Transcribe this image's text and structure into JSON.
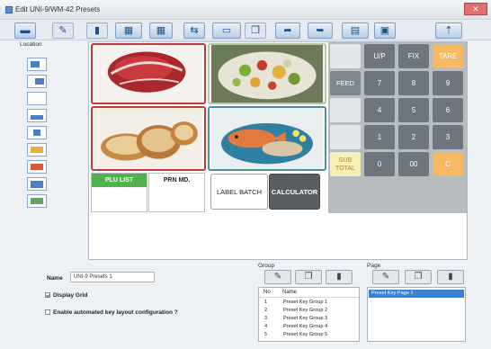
{
  "window": {
    "title": "Edit UNI-9/WM-42 Presets"
  },
  "location": {
    "label": "Location"
  },
  "keyboard": {
    "plu_list_label": "PLU LIST",
    "prn_mode_label": "PRN MD.",
    "label_batch_label": "LABEL BATCH",
    "calculator_label": "CALCULATOR",
    "numpad": {
      "up_label": "U/P",
      "fix_label": "FIX",
      "tare_label": "TARE",
      "feed_label": "FEED",
      "k7": "7",
      "k8": "8",
      "k9": "9",
      "k4": "4",
      "k5": "5",
      "k6": "6",
      "k1": "1",
      "k2": "2",
      "k3": "3",
      "sub_total_line1": "SUB",
      "sub_total_line2": "TOTAL",
      "k0": "0",
      "k00": "00",
      "c_label": "C"
    }
  },
  "form": {
    "name_label": "Name",
    "name_value": "UNI-9 Presets 1",
    "display_grid_label": "Display Grid",
    "display_grid_checked": true,
    "auto_layout_label": "Enable automated key layout configuration ?",
    "auto_layout_checked": false
  },
  "group": {
    "label": "Group",
    "col_no": "No",
    "col_name": "Name",
    "rows": [
      {
        "no": "1",
        "name": "Preset Key Group 1"
      },
      {
        "no": "2",
        "name": "Preset Key Group 2"
      },
      {
        "no": "3",
        "name": "Preset Key Group 3"
      },
      {
        "no": "4",
        "name": "Preset Key Group 4"
      },
      {
        "no": "5",
        "name": "Preset Key Group 5"
      }
    ]
  },
  "page": {
    "label": "Page",
    "selected_item": "Preset Key Page 1"
  },
  "colors": {
    "plu_green": "#4fb24f",
    "tare_orange": "#f5b964",
    "selection_blue": "#3d7fd1",
    "numpad_grey": "#6e757c"
  }
}
